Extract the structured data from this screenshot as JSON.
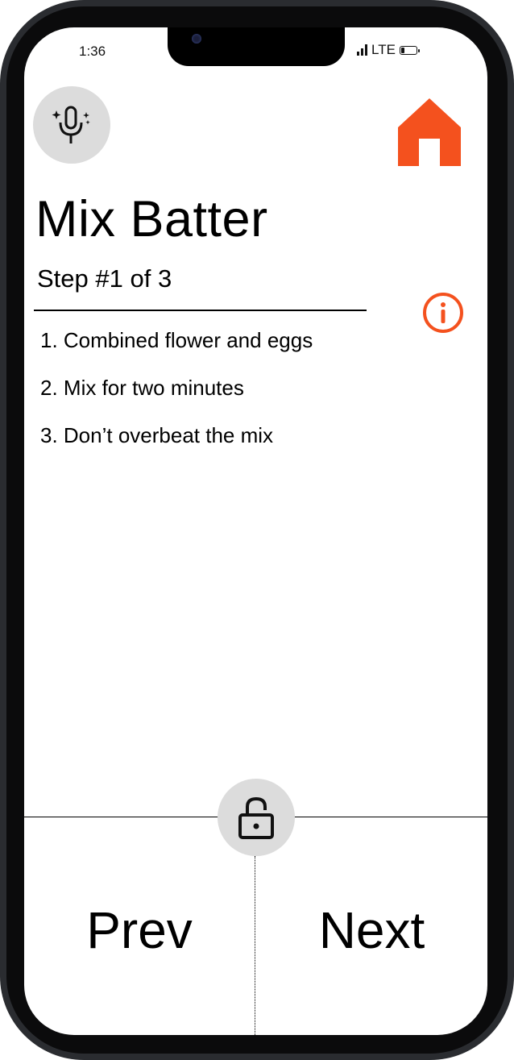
{
  "status_bar": {
    "time": "1:36",
    "network": "LTE",
    "battery_level": 0.25
  },
  "icons": {
    "voice": "voice-assistant-mic-sparkle-icon",
    "home": "home-icon",
    "info": "info-icon",
    "lock": "lock-icon"
  },
  "colors": {
    "accent": "#F4511E",
    "button_bg": "#DCDCDC"
  },
  "recipe": {
    "title": "Mix Batter",
    "step_label": "Step #1 of 3",
    "instructions": [
      "1. Combined flower and eggs",
      "2. Mix for two minutes",
      "3. Don’t overbeat the mix"
    ]
  },
  "navigation": {
    "prev_label": "Prev",
    "next_label": "Next"
  }
}
